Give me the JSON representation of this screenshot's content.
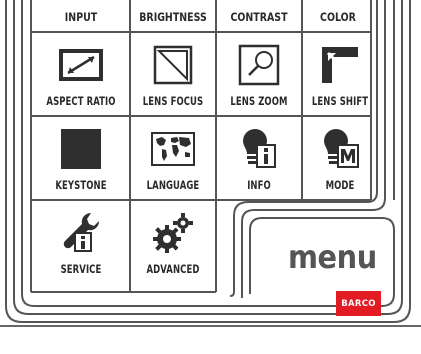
{
  "remote": {
    "top_row": [
      "INPUT",
      "BRIGHTNESS",
      "CONTRAST",
      "COLOR"
    ],
    "buttons": [
      {
        "label": "ASPECT RATIO",
        "icon": "aspect-ratio-icon"
      },
      {
        "label": "LENS FOCUS",
        "icon": "lens-focus-icon"
      },
      {
        "label": "LENS ZOOM",
        "icon": "lens-zoom-icon"
      },
      {
        "label": "LENS SHIFT",
        "icon": "lens-shift-icon"
      },
      {
        "label": "KEYSTONE",
        "icon": "keystone-icon"
      },
      {
        "label": "LANGUAGE",
        "icon": "world-map-icon"
      },
      {
        "label": "INFO",
        "icon": "info-bulb-icon"
      },
      {
        "label": "MODE",
        "icon": "mode-bulb-icon"
      },
      {
        "label": "SERVICE",
        "icon": "service-wrench-icon"
      },
      {
        "label": "ADVANCED",
        "icon": "gears-icon"
      }
    ],
    "menu_label": "menu",
    "brand": "BARCO",
    "colors": {
      "brand": "#e31b23",
      "icon": "#2f2f2f",
      "frame": "#555555"
    }
  }
}
